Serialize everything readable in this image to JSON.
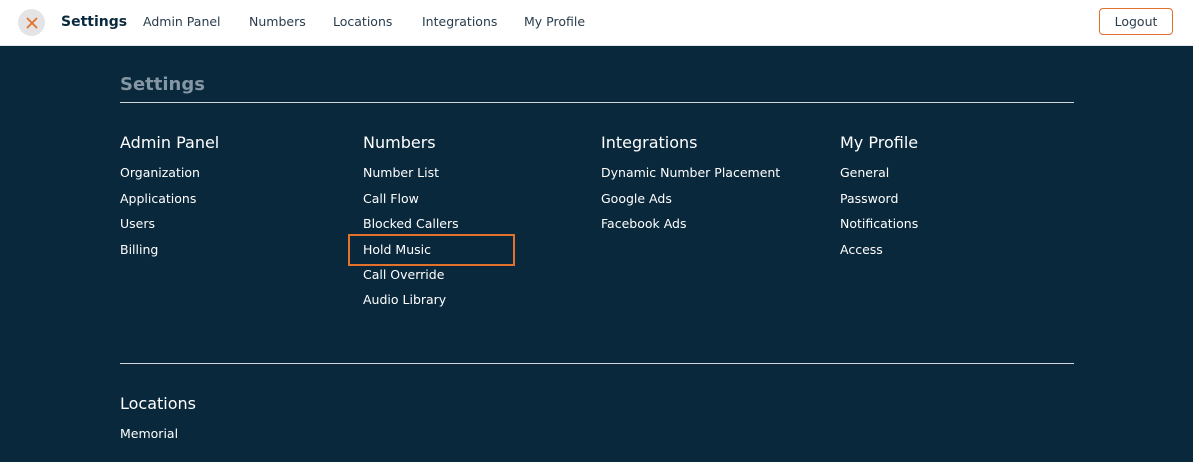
{
  "topbar": {
    "title": "Settings",
    "nav": [
      "Admin Panel",
      "Numbers",
      "Locations",
      "Integrations",
      "My Profile"
    ],
    "logout_label": "Logout",
    "accent_color": "#e3702b"
  },
  "panel": {
    "title": "Settings",
    "background_color": "#0a283c",
    "sections": {
      "admin_panel": {
        "title": "Admin Panel",
        "links": [
          "Organization",
          "Applications",
          "Users",
          "Billing"
        ]
      },
      "numbers": {
        "title": "Numbers",
        "links": [
          "Number List",
          "Call Flow",
          "Blocked Callers",
          "Hold Music",
          "Call Override",
          "Audio Library"
        ],
        "highlighted": "Hold Music"
      },
      "integrations": {
        "title": "Integrations",
        "links": [
          "Dynamic Number Placement",
          "Google Ads",
          "Facebook Ads"
        ]
      },
      "my_profile": {
        "title": "My Profile",
        "links": [
          "General",
          "Password",
          "Notifications",
          "Access"
        ]
      },
      "locations": {
        "title": "Locations",
        "links": [
          "Memorial"
        ]
      }
    }
  }
}
